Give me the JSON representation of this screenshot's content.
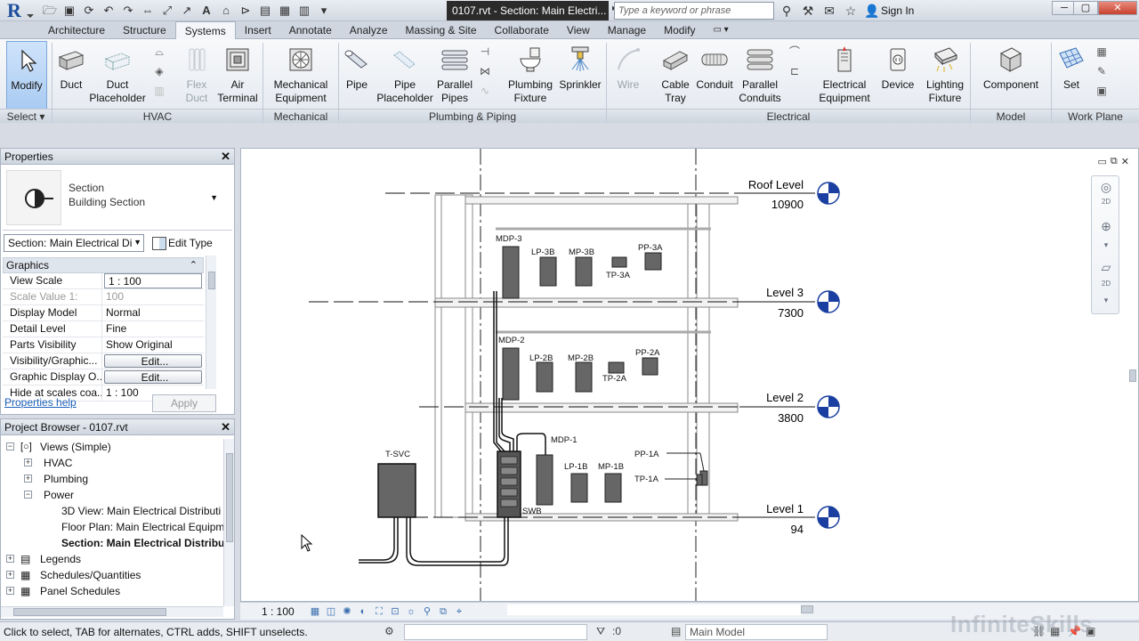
{
  "titlebar": {
    "document_title": "0107.rvt - Section: Main Electri...",
    "search_placeholder": "Type a keyword or phrase",
    "sign_in": "Sign In"
  },
  "tabs": [
    {
      "label": "Architecture"
    },
    {
      "label": "Structure"
    },
    {
      "label": "Systems",
      "active": true
    },
    {
      "label": "Insert"
    },
    {
      "label": "Annotate"
    },
    {
      "label": "Analyze"
    },
    {
      "label": "Massing & Site"
    },
    {
      "label": "Collaborate"
    },
    {
      "label": "View"
    },
    {
      "label": "Manage"
    },
    {
      "label": "Modify"
    },
    {
      "label": "▭ ▾"
    }
  ],
  "ribbon": {
    "buttons": {
      "modify": "Modify",
      "duct": "Duct",
      "duct_placeholder_1": "Duct",
      "duct_placeholder_2": "Placeholder",
      "flex_duct_1": "Flex",
      "flex_duct_2": "Duct",
      "air_terminal_1": "Air",
      "air_terminal_2": "Terminal",
      "mechanical_equipment_1": "Mechanical",
      "mechanical_equipment_2": "Equipment",
      "pipe": "Pipe",
      "pipe_placeholder_1": "Pipe",
      "pipe_placeholder_2": "Placeholder",
      "parallel_pipes_1": "Parallel",
      "parallel_pipes_2": "Pipes",
      "plumbing_fixture_1": "Plumbing",
      "plumbing_fixture_2": "Fixture",
      "sprinkler": "Sprinkler",
      "wire": "Wire",
      "cable_tray_1": "Cable",
      "cable_tray_2": "Tray",
      "conduit": "Conduit",
      "parallel_conduits_1": "Parallel",
      "parallel_conduits_2": "Conduits",
      "electrical_equipment_1": "Electrical",
      "electrical_equipment_2": "Equipment",
      "device": "Device",
      "lighting_fixture_1": "Lighting",
      "lighting_fixture_2": "Fixture",
      "component": "Component",
      "set": "Set"
    },
    "panels": {
      "select": "Select ▾",
      "hvac": "HVAC",
      "mechanical": "Mechanical",
      "plumbing_piping": "Plumbing & Piping",
      "electrical": "Electrical",
      "model": "Model",
      "work_plane": "Work Plane"
    }
  },
  "properties": {
    "title": "Properties",
    "type_line1": "Section",
    "type_line2": "Building Section",
    "instance": "Section: Main Electrical Di",
    "edit_type": "Edit Type",
    "group": "Graphics",
    "rows": [
      {
        "name": "View Scale",
        "value": "1 : 100"
      },
      {
        "name": "Scale Value   1:",
        "value": "100"
      },
      {
        "name": "Display Model",
        "value": "Normal"
      },
      {
        "name": "Detail Level",
        "value": "Fine"
      },
      {
        "name": "Parts Visibility",
        "value": "Show Original"
      },
      {
        "name": "Visibility/Graphic...",
        "value": "Edit..."
      },
      {
        "name": "Graphic Display O...",
        "value": "Edit..."
      },
      {
        "name": "Hide at scales coa...",
        "value": "1 : 100"
      }
    ],
    "help_link": "Properties help",
    "apply": "Apply"
  },
  "browser": {
    "title": "Project Browser - 0107.rvt",
    "nodes": [
      {
        "label": "Views (Simple)"
      },
      {
        "label": "HVAC"
      },
      {
        "label": "Plumbing"
      },
      {
        "label": "Power"
      },
      {
        "label": "3D View: Main Electrical Distributi"
      },
      {
        "label": "Floor Plan: Main Electrical Equipm"
      },
      {
        "label": "Section: Main Electrical Distribut"
      },
      {
        "label": "Legends"
      },
      {
        "label": "Schedules/Quantities"
      },
      {
        "label": "Panel Schedules"
      }
    ]
  },
  "drawing": {
    "levels": [
      {
        "name": "Roof Level",
        "elevation": "10900"
      },
      {
        "name": "Level 3",
        "elevation": "7300"
      },
      {
        "name": "Level 2",
        "elevation": "3800"
      },
      {
        "name": "Level 1",
        "elevation": "94"
      }
    ],
    "equipment": {
      "mdp3": "MDP-3",
      "lp3b": "LP-3B",
      "mp3b": "MP-3B",
      "tp3a": "TP-3A",
      "pp3a": "PP-3A",
      "mdp2": "MDP-2",
      "lp2b": "LP-2B",
      "mp2b": "MP-2B",
      "tp2a": "TP-2A",
      "pp2a": "PP-2A",
      "mdp1": "MDP-1",
      "lp1b": "LP-1B",
      "mp1b": "MP-1B",
      "pp1a": "PP-1A",
      "tp1a": "TP-1A",
      "tsvc": "T-SVC",
      "swb": "SWB"
    }
  },
  "viewbar": {
    "scale": "1 : 100"
  },
  "statusbar": {
    "message": "Click to select, TAB for alternates, CTRL adds, SHIFT unselects.",
    "filter_count": ":0",
    "model": "Main Model"
  },
  "watermark": "InfiniteSkills"
}
